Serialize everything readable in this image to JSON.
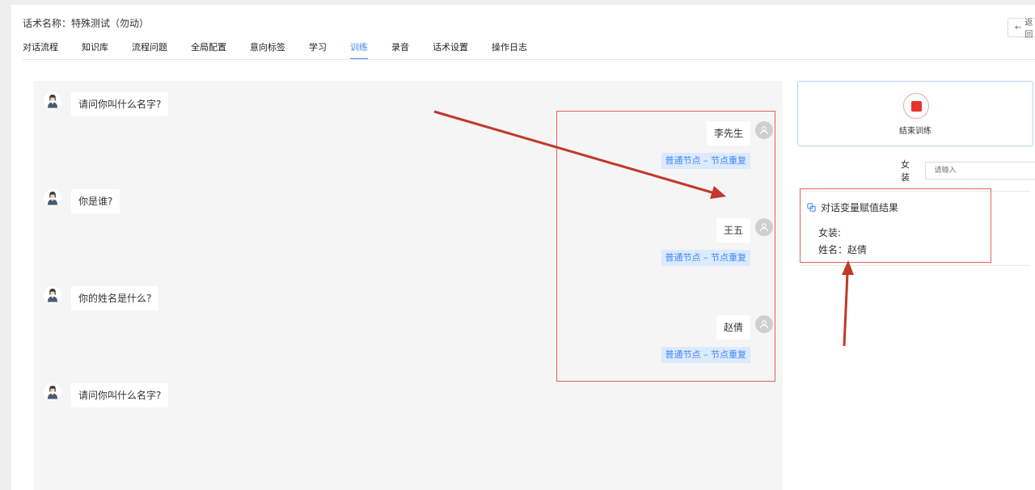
{
  "header": {
    "script_title": "话术名称：特殊测试（勿动）",
    "back_icon": "arrow-left-icon",
    "back_label": "返回"
  },
  "tabs": [
    {
      "label": "对话流程",
      "active": false
    },
    {
      "label": "知识库",
      "active": false
    },
    {
      "label": "流程问题",
      "active": false
    },
    {
      "label": "全局配置",
      "active": false
    },
    {
      "label": "意向标签",
      "active": false
    },
    {
      "label": "学习",
      "active": false
    },
    {
      "label": "训练",
      "active": true
    },
    {
      "label": "录音",
      "active": false
    },
    {
      "label": "话术设置",
      "active": false
    },
    {
      "label": "操作日志",
      "active": false
    }
  ],
  "chat": {
    "bot_messages": [
      {
        "text": "请问你叫什么名字?"
      },
      {
        "text": "你是谁?"
      },
      {
        "text": "你的姓名是什么?"
      },
      {
        "text": "请问你叫什么名字?"
      }
    ],
    "user_messages": [
      {
        "text": "李先生",
        "tag": "普通节点 – 节点重复"
      },
      {
        "text": "王五",
        "tag": "普通节点 – 节点重复"
      },
      {
        "text": "赵倩",
        "tag": "普通节点 – 节点重复"
      }
    ]
  },
  "training": {
    "end_label": "结束训练",
    "field_label": "女装",
    "field_placeholder": "请输入"
  },
  "result": {
    "title": "对话变量赋值结果",
    "lines": [
      {
        "text": "女装:"
      },
      {
        "text": "姓名：赵倩"
      }
    ]
  },
  "colors": {
    "accent": "#3f87f5",
    "tag_bg": "#dbeafc",
    "end_red": "#e8312d",
    "annotation_red": "#e2625a",
    "arrow_red": "#c0392b"
  }
}
